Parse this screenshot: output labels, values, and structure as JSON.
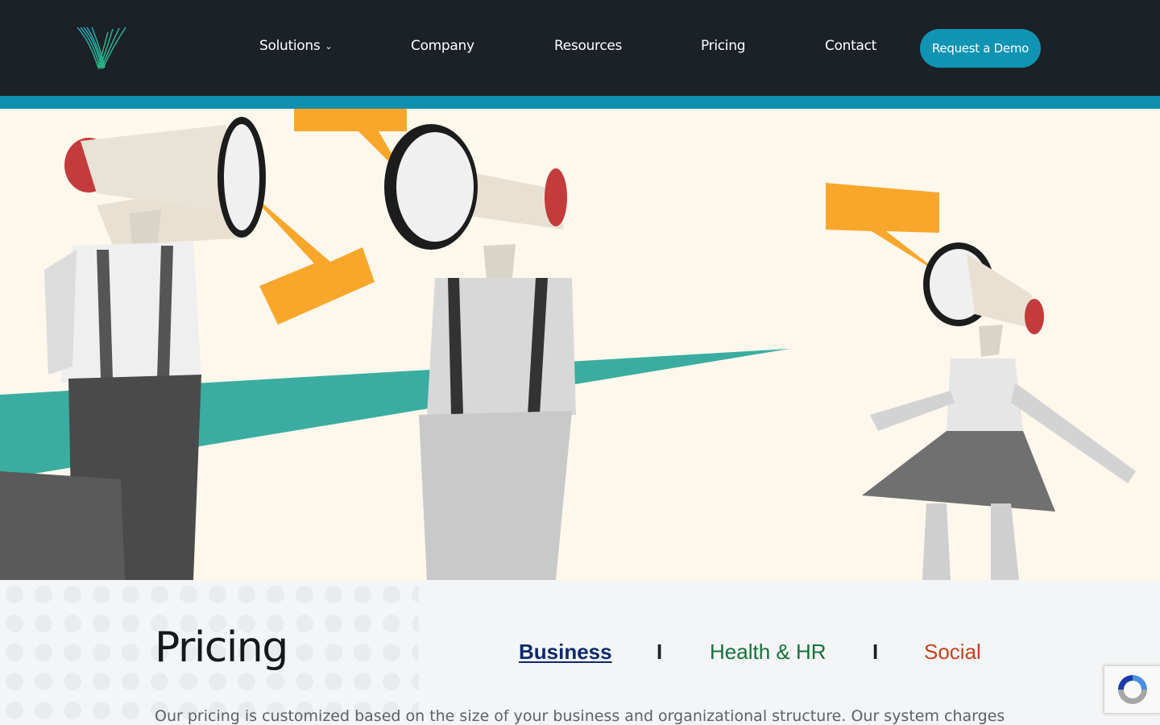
{
  "header": {
    "logo_name": "brand-logo",
    "nav": [
      {
        "label": "Solutions",
        "has_dropdown": true
      },
      {
        "label": "Company"
      },
      {
        "label": "Resources"
      },
      {
        "label": "Pricing"
      },
      {
        "label": "Contact"
      }
    ],
    "cta_label": "Request a Demo"
  },
  "hero": {
    "image": "megaphone-heads-illustration"
  },
  "pricing": {
    "title": "Pricing",
    "tabs": [
      {
        "label": "Business",
        "active": true,
        "color": "#0d2a6b"
      },
      {
        "label": "Health & HR",
        "color": "#13733a"
      },
      {
        "label": "Social",
        "color": "#c8401c"
      }
    ],
    "separator": "I",
    "intro": "Our pricing is customized based on the size of your business and organizational structure. Our system charges"
  },
  "colors": {
    "header_bg": "#1c2127",
    "accent": "#0d8fae",
    "hero_bg": "#fdf7ec",
    "speech_bubble": "#f9a72b",
    "teal_ray": "#3aada0"
  }
}
